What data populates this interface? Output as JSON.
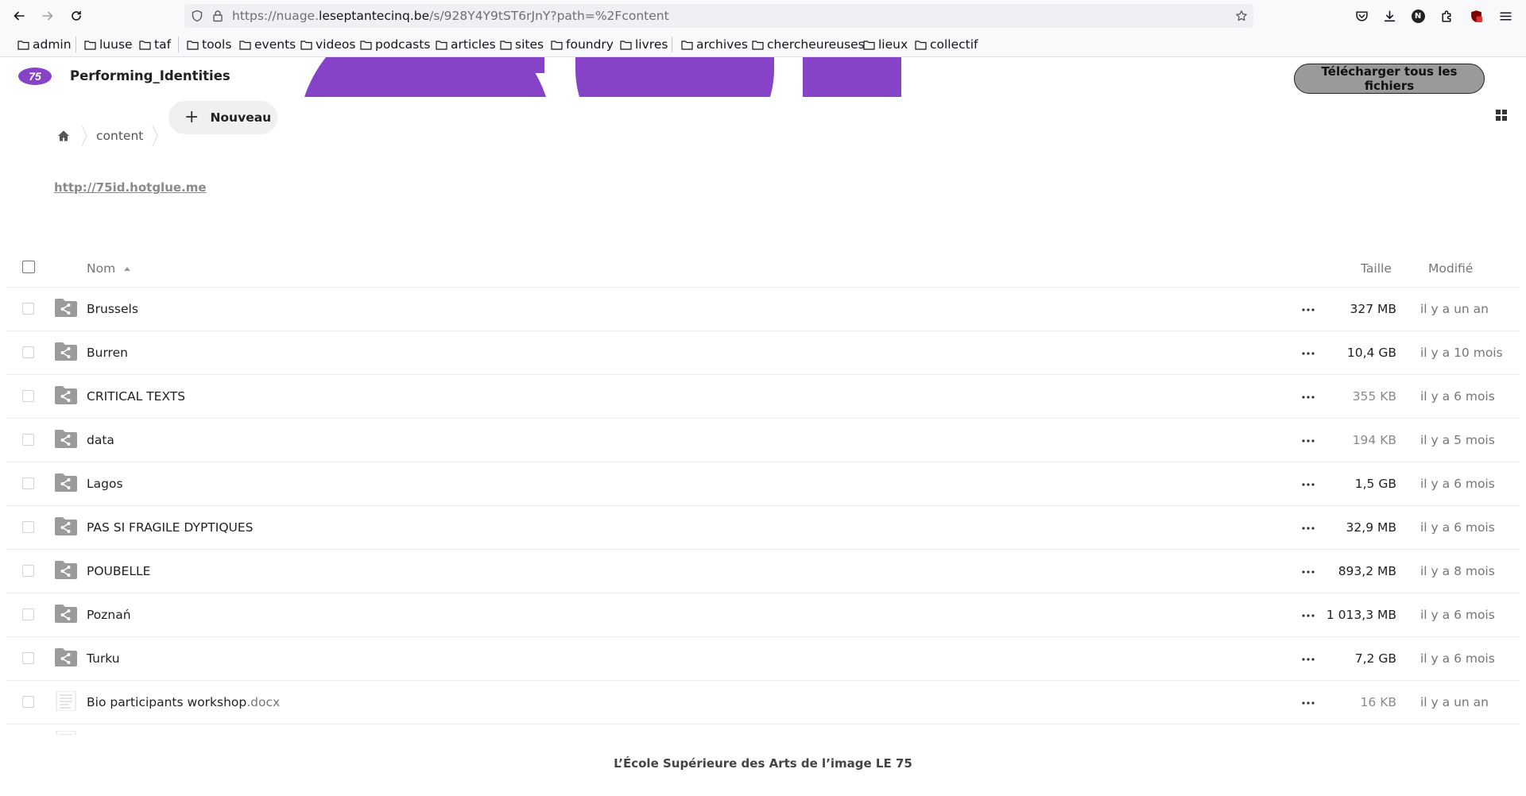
{
  "browser": {
    "url_prefix": "https://nuage.",
    "url_host": "leseptantecinq.be",
    "url_path": "/s/928Y4Y9tST6rJnY?path=%2Fcontent",
    "bookmarks": [
      "admin",
      "luuse",
      "taf",
      "tools",
      "events",
      "videos",
      "podcasts",
      "articles",
      "sites",
      "foundry",
      "livres",
      "archives",
      "chercheureuses",
      "lieux",
      "collectif"
    ],
    "account_initial": "N"
  },
  "app": {
    "title": "Performing_Identities",
    "download_all_label": "Télécharger tous les fichiers",
    "brand_color": "#8743c7"
  },
  "breadcrumb": {
    "current": "content",
    "new_button_label": "Nouveau"
  },
  "readme": {
    "link_text": "http://75id.hotglue.me"
  },
  "list": {
    "columns": {
      "name": "Nom",
      "size": "Taille",
      "modified": "Modifié"
    },
    "files": [
      {
        "name": "Brussels",
        "ext": "",
        "type": "shared-folder",
        "size": "327 MB",
        "modified": "il y a un an",
        "size_strong": true
      },
      {
        "name": "Burren",
        "ext": "",
        "type": "shared-folder",
        "size": "10,4 GB",
        "modified": "il y a 10 mois",
        "size_strong": true
      },
      {
        "name": "CRITICAL TEXTS",
        "ext": "",
        "type": "shared-folder",
        "size": "355 KB",
        "modified": "il y a 6 mois",
        "size_strong": false
      },
      {
        "name": "data",
        "ext": "",
        "type": "shared-folder",
        "size": "194 KB",
        "modified": "il y a 5 mois",
        "size_strong": false
      },
      {
        "name": "Lagos",
        "ext": "",
        "type": "shared-folder",
        "size": "1,5 GB",
        "modified": "il y a 6 mois",
        "size_strong": true
      },
      {
        "name": "PAS SI FRAGILE DYPTIQUES",
        "ext": "",
        "type": "shared-folder",
        "size": "32,9 MB",
        "modified": "il y a 6 mois",
        "size_strong": true
      },
      {
        "name": "POUBELLE",
        "ext": "",
        "type": "shared-folder",
        "size": "893,2 MB",
        "modified": "il y a 8 mois",
        "size_strong": true
      },
      {
        "name": "Poznań",
        "ext": "",
        "type": "shared-folder",
        "size": "1 013,3 MB",
        "modified": "il y a 6 mois",
        "size_strong": true
      },
      {
        "name": "Turku",
        "ext": "",
        "type": "shared-folder",
        "size": "7,2 GB",
        "modified": "il y a 6 mois",
        "size_strong": true
      },
      {
        "name": "Bio participants workshop",
        "ext": ".docx",
        "type": "document",
        "size": "16 KB",
        "modified": "il y a un an",
        "size_strong": false
      }
    ]
  },
  "footer": {
    "text": "L’École Supérieure des Arts de l’image LE 75"
  }
}
